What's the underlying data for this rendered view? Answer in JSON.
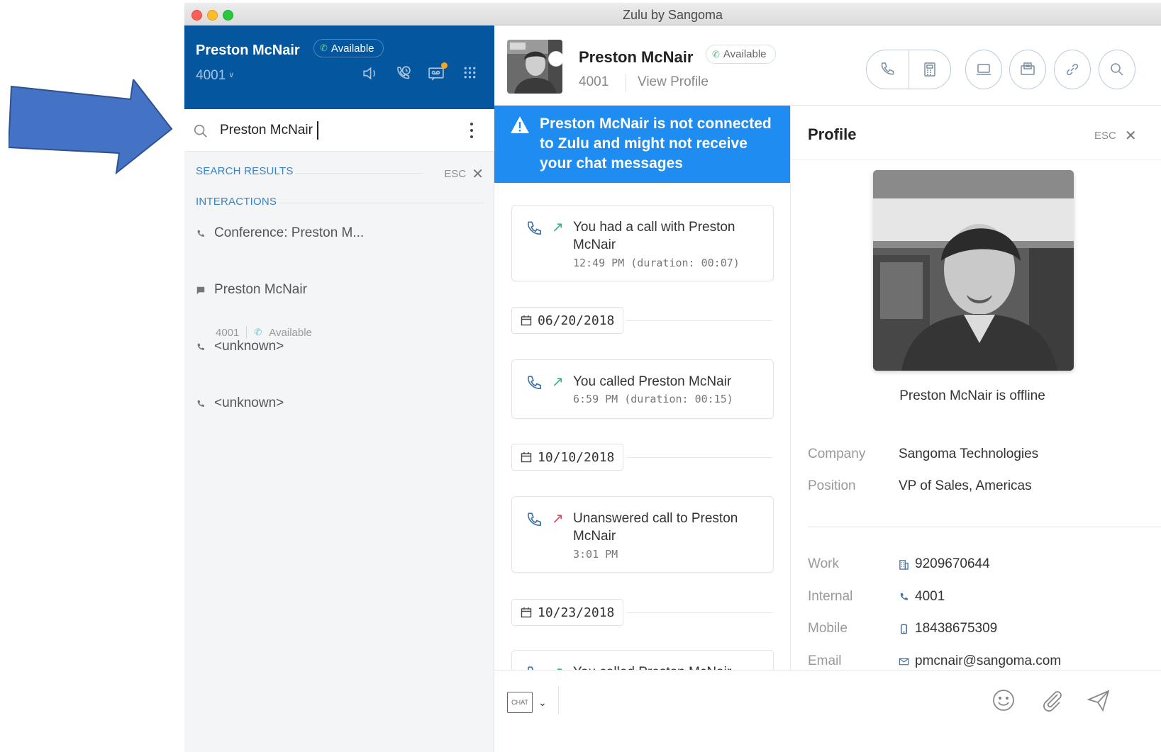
{
  "window_title": "Zulu by Sangoma",
  "current_user": {
    "name": "Preston McNair",
    "status": "Available",
    "extension": "4001"
  },
  "search": {
    "value": "Preston McNair",
    "section_label": "SEARCH RESULTS",
    "esc_label": "ESC",
    "interactions_label": "INTERACTIONS"
  },
  "results": [
    {
      "label": "Conference: Preston M...",
      "icon": "phone-icon"
    },
    {
      "label": "Preston McNair",
      "icon": "chat-icon",
      "extension": "4001",
      "status": "Available"
    },
    {
      "label": "<unknown>",
      "icon": "phone-icon"
    },
    {
      "label": "<unknown>",
      "icon": "phone-icon"
    }
  ],
  "conversation": {
    "name": "Preston McNair",
    "status": "Available",
    "extension": "4001",
    "view_profile": "View Profile"
  },
  "alert_text": "Preston McNair is not connected to Zulu and might not receive your chat messages",
  "feed": [
    {
      "type": "call",
      "direction": "outgoing-answered",
      "text": "You had a call with Preston McNair",
      "meta": "12:49 PM (duration: 00:07)"
    },
    {
      "type": "date",
      "text": "06/20/2018"
    },
    {
      "type": "call",
      "direction": "outgoing-answered",
      "text": "You called Preston McNair",
      "meta": "6:59 PM (duration: 00:15)"
    },
    {
      "type": "date",
      "text": "10/10/2018"
    },
    {
      "type": "call",
      "direction": "outgoing-unanswered",
      "text": "Unanswered call to Preston McNair",
      "meta": "3:01 PM"
    },
    {
      "type": "date",
      "text": "10/23/2018"
    },
    {
      "type": "call",
      "direction": "outgoing-answered",
      "text": "You called Preston McNair",
      "meta": ""
    }
  ],
  "composer": {
    "mode": "CHAT"
  },
  "profile": {
    "title": "Profile",
    "esc_label": "ESC",
    "offline_text": "Preston McNair is offline",
    "company_label": "Company",
    "company": "Sangoma Technologies",
    "position_label": "Position",
    "position": "VP of Sales, Americas",
    "work_label": "Work",
    "work": "9209670644",
    "internal_label": "Internal",
    "internal": "4001",
    "mobile_label": "Mobile",
    "mobile": "18438675309",
    "email_label": "Email",
    "email": "pmcnair@sangoma.com"
  },
  "colors": {
    "header_blue": "#04569e",
    "alert_blue": "#1e8cf0",
    "arrow_blue": "#4472c4",
    "available_green": "#4cc27a",
    "unanswered_red": "#e0475b"
  }
}
